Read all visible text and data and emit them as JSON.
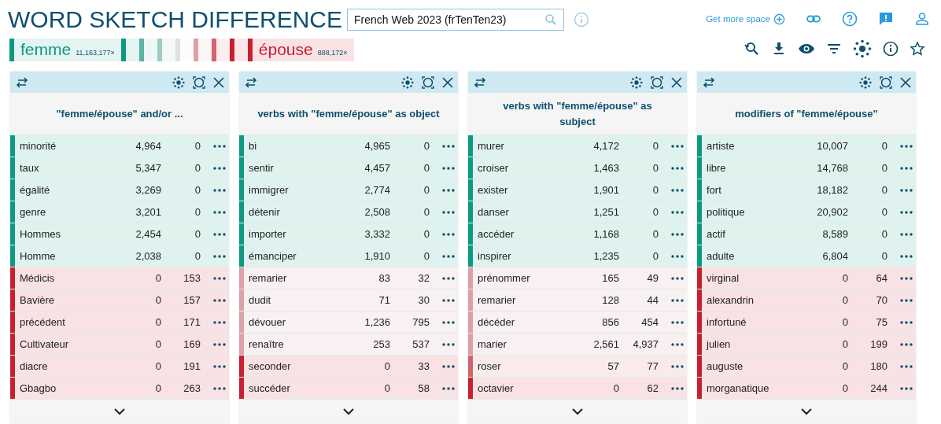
{
  "title": "WORD SKETCH DIFFERENCE",
  "corpus_field": {
    "value": "French Web 2023 (frTenTen23)"
  },
  "top_links": {
    "more_space": "Get more space"
  },
  "legend": {
    "left": {
      "word": "femme",
      "count": "11,163,177×",
      "color": "#0b9a80"
    },
    "scale": [
      {
        "color": "#0b9a80"
      },
      {
        "color": "#5bb3a4"
      },
      {
        "color": "#9ccbc1"
      },
      {
        "color": "#e0e0e0"
      },
      {
        "color": "#dca0a6"
      },
      {
        "color": "#d2646e"
      },
      {
        "color": "#c8202f"
      }
    ],
    "right": {
      "word": "épouse",
      "count": "888,172×",
      "color": "#c8202f"
    }
  },
  "panels": [
    {
      "title": "\"femme/épouse\" and/or ...",
      "rows": [
        {
          "word": "minorité",
          "a": "4,964",
          "b": "0",
          "color": "#0b9a80"
        },
        {
          "word": "taux",
          "a": "5,347",
          "b": "0",
          "color": "#0b9a80"
        },
        {
          "word": "égalité",
          "a": "3,269",
          "b": "0",
          "color": "#0b9a80"
        },
        {
          "word": "genre",
          "a": "3,201",
          "b": "0",
          "color": "#0b9a80"
        },
        {
          "word": "Hommes",
          "a": "2,454",
          "b": "0",
          "color": "#0b9a80"
        },
        {
          "word": "Homme",
          "a": "2,038",
          "b": "0",
          "color": "#0b9a80"
        },
        {
          "word": "Médicis",
          "a": "0",
          "b": "153",
          "color": "#c8202f"
        },
        {
          "word": "Bavière",
          "a": "0",
          "b": "157",
          "color": "#c8202f"
        },
        {
          "word": "précédent",
          "a": "0",
          "b": "171",
          "color": "#c8202f"
        },
        {
          "word": "Cultivateur",
          "a": "0",
          "b": "169",
          "color": "#c8202f"
        },
        {
          "word": "diacre",
          "a": "0",
          "b": "191",
          "color": "#c8202f"
        },
        {
          "word": "Gbagbo",
          "a": "0",
          "b": "263",
          "color": "#c8202f"
        }
      ]
    },
    {
      "title": "verbs with \"femme/épouse\" as object",
      "rows": [
        {
          "word": "bi",
          "a": "4,965",
          "b": "0",
          "color": "#0b9a80"
        },
        {
          "word": "sentir",
          "a": "4,457",
          "b": "0",
          "color": "#0b9a80"
        },
        {
          "word": "immigrer",
          "a": "2,774",
          "b": "0",
          "color": "#0b9a80"
        },
        {
          "word": "détenir",
          "a": "2,508",
          "b": "0",
          "color": "#0b9a80"
        },
        {
          "word": "importer",
          "a": "3,332",
          "b": "0",
          "color": "#0b9a80"
        },
        {
          "word": "émanciper",
          "a": "1,910",
          "b": "0",
          "color": "#0b9a80"
        },
        {
          "word": "remarier",
          "a": "83",
          "b": "32",
          "color": "#dca0a6"
        },
        {
          "word": "dudit",
          "a": "71",
          "b": "30",
          "color": "#dca0a6"
        },
        {
          "word": "dévouer",
          "a": "1,236",
          "b": "795",
          "color": "#dca0a6"
        },
        {
          "word": "renaître",
          "a": "253",
          "b": "537",
          "color": "#dca0a6"
        },
        {
          "word": "seconder",
          "a": "0",
          "b": "33",
          "color": "#c8202f"
        },
        {
          "word": "succéder",
          "a": "0",
          "b": "58",
          "color": "#c8202f"
        }
      ]
    },
    {
      "title": "verbs with \"femme/épouse\" as subject",
      "rows": [
        {
          "word": "murer",
          "a": "4,172",
          "b": "0",
          "color": "#0b9a80"
        },
        {
          "word": "croiser",
          "a": "1,463",
          "b": "0",
          "color": "#0b9a80"
        },
        {
          "word": "exister",
          "a": "1,901",
          "b": "0",
          "color": "#0b9a80"
        },
        {
          "word": "danser",
          "a": "1,251",
          "b": "0",
          "color": "#0b9a80"
        },
        {
          "word": "accéder",
          "a": "1,168",
          "b": "0",
          "color": "#0b9a80"
        },
        {
          "word": "inspirer",
          "a": "1,235",
          "b": "0",
          "color": "#0b9a80"
        },
        {
          "word": "prénommer",
          "a": "165",
          "b": "49",
          "color": "#dca0a6"
        },
        {
          "word": "remarier",
          "a": "128",
          "b": "44",
          "color": "#dca0a6"
        },
        {
          "word": "décéder",
          "a": "856",
          "b": "454",
          "color": "#dca0a6"
        },
        {
          "word": "marier",
          "a": "2,561",
          "b": "4,937",
          "color": "#dca0a6"
        },
        {
          "word": "roser",
          "a": "57",
          "b": "77",
          "color": "#d2646e"
        },
        {
          "word": "octavier",
          "a": "0",
          "b": "62",
          "color": "#c8202f"
        }
      ]
    },
    {
      "title": "modifiers of \"femme/épouse\"",
      "rows": [
        {
          "word": "artiste",
          "a": "10,007",
          "b": "0",
          "color": "#0b9a80"
        },
        {
          "word": "libre",
          "a": "14,768",
          "b": "0",
          "color": "#0b9a80"
        },
        {
          "word": "fort",
          "a": "18,182",
          "b": "0",
          "color": "#0b9a80"
        },
        {
          "word": "politique",
          "a": "20,902",
          "b": "0",
          "color": "#0b9a80"
        },
        {
          "word": "actif",
          "a": "8,589",
          "b": "0",
          "color": "#0b9a80"
        },
        {
          "word": "adulte",
          "a": "6,804",
          "b": "0",
          "color": "#0b9a80"
        },
        {
          "word": "virginal",
          "a": "0",
          "b": "64",
          "color": "#c8202f"
        },
        {
          "word": "alexandrin",
          "a": "0",
          "b": "70",
          "color": "#c8202f"
        },
        {
          "word": "infortuné",
          "a": "0",
          "b": "75",
          "color": "#c8202f"
        },
        {
          "word": "julien",
          "a": "0",
          "b": "199",
          "color": "#c8202f"
        },
        {
          "word": "auguste",
          "a": "0",
          "b": "180",
          "color": "#c8202f"
        },
        {
          "word": "morganatique",
          "a": "0",
          "b": "244",
          "color": "#c8202f"
        }
      ]
    }
  ]
}
